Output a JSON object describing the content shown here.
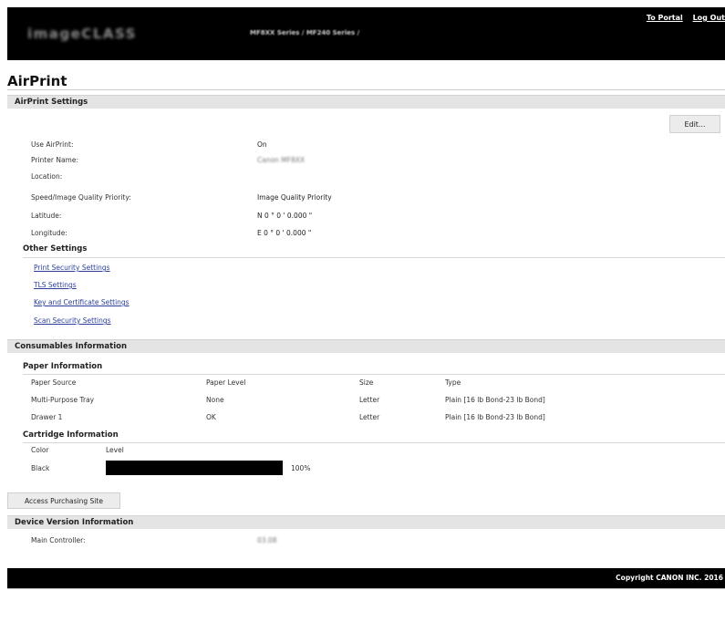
{
  "header": {
    "logo": "imageCLASS",
    "model": "MF8XX Series / MF240 Series /",
    "links": {
      "portal": "To Portal",
      "logout": "Log Out"
    }
  },
  "page": {
    "title": "AirPrint"
  },
  "airprint_settings": {
    "title": "AirPrint Settings",
    "edit_label": "Edit...",
    "rows": [
      {
        "label": "Use AirPrint:",
        "value": "On"
      },
      {
        "label": "Printer Name:",
        "value": "Canon MF8XX"
      },
      {
        "label": "Location:",
        "value": ""
      },
      {
        "label": "Speed/Image Quality Priority:",
        "value": "Image Quality Priority"
      },
      {
        "label": "Latitude:",
        "value": "N 0 ° 0 ' 0.000 \""
      },
      {
        "label": "Longitude:",
        "value": "E 0 ° 0 ' 0.000 \""
      }
    ]
  },
  "other_settings": {
    "title": "Other Settings",
    "links": [
      "Print Security Settings",
      "TLS Settings",
      "Key and Certificate Settings",
      "Scan Security Settings"
    ]
  },
  "consumables": {
    "title": "Consumables Information",
    "paper": {
      "title": "Paper Information",
      "headers": [
        "Paper Source",
        "Paper Level",
        "Size",
        "Type"
      ],
      "rows": [
        [
          "Multi-Purpose Tray",
          "None",
          "Letter",
          "Plain [16 lb Bond-23 lb Bond]"
        ],
        [
          "Drawer 1",
          "OK",
          "Letter",
          "Plain [16 lb Bond-23 lb Bond]"
        ]
      ]
    },
    "cartridge": {
      "title": "Cartridge Information",
      "headers": [
        "Color",
        "Level"
      ],
      "rows": [
        {
          "color": "Black",
          "level_text": "100%",
          "level_fraction": 1.0
        }
      ]
    },
    "purchase_label": "Access Purchasing Site"
  },
  "device_version": {
    "title": "Device Version Information",
    "rows": [
      {
        "label": "Main Controller:",
        "value": "03.08"
      }
    ]
  },
  "footer": {
    "copyright": "Copyright CANON INC. 2016"
  },
  "colors": {
    "header_bg": "#000000",
    "section_bar": "#e4e4e4",
    "link": "#2b3f9a",
    "level_bar": "#000000"
  }
}
